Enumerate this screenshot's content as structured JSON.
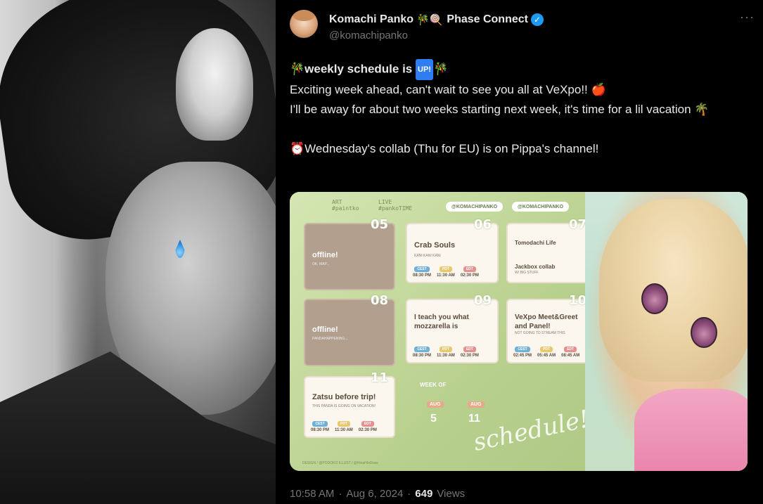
{
  "tweet": {
    "display_name": "Komachi Panko",
    "name_emojis": "🎋🍭",
    "organization": "Phase Connect",
    "handle": "@komachipanko",
    "more_label": "···",
    "body": {
      "line1_prefix_emoji": "🎋",
      "line1_text": "weekly schedule is",
      "line1_badge": "UP!",
      "line1_suffix_emoji": "🎋",
      "line2": "Exciting week ahead, can't wait to see you all at VeXpo!! 🍎",
      "line3": "I'll be away for about two weeks starting next week, it's time for a lil vacation 🌴",
      "line4_emoji": "⏰",
      "line4_text": "Wednesday's collab (Thu for EU) is on Pippa's channel!"
    },
    "meta": {
      "time": "10:58 AM",
      "sep1": "·",
      "date": "Aug 6, 2024",
      "sep2": "·",
      "views_count": "649",
      "views_label": "Views"
    }
  },
  "schedule": {
    "header_art": "ART",
    "header_art_tag": "#paintko",
    "header_live": "LIVE",
    "header_live_tag": "#pankoTIME",
    "handle_twitter": "@KOMACHIPANKO",
    "handle_youtube": "@KOMACHIPANKO",
    "days": [
      {
        "num": "05",
        "title": "offline!",
        "sub": "OK, MAP...",
        "offline": true
      },
      {
        "num": "06",
        "title": "Crab Souls",
        "sub": "KANI KANI KANI",
        "times": [
          "08:30 PM",
          "11:30 AM",
          "02:30 PM"
        ]
      },
      {
        "num": "07",
        "title": "Tomodachi Life",
        "title2": "Jackbox collab",
        "sub": "W/ BIG STUFF"
      },
      {
        "num": "08",
        "title": "offline!",
        "sub": "PANDAHAPPENING...",
        "offline": true
      },
      {
        "num": "09",
        "title": "I teach you what mozzarella is",
        "times": [
          "08:30 PM",
          "11:30 AM",
          "02:30 PM"
        ]
      },
      {
        "num": "10",
        "title": "VeXpo Meet&Greet and Panel!",
        "sub": "NOT GOING TO STREAM THIS",
        "times": [
          "02:45 PM",
          "05:45 AM",
          "08:45 AM"
        ]
      },
      {
        "num": "11",
        "title": "Zatsu before trip!",
        "sub": "THIS PANDA IS GOING ON VACATION!",
        "times": [
          "08:30 PM",
          "11:30 AM",
          "02:30 PM"
        ]
      }
    ],
    "tz_labels": [
      "CEST",
      "PDT",
      "EDT"
    ],
    "week_of_label": "WEEK OF",
    "week_from_month": "AUG",
    "week_from_day": "5",
    "week_to_month": "AUG",
    "week_to_day": "11",
    "script_text": "schedule!",
    "credits": "DESIGN / @PODOKO  ILLUST / @HinaHInDraw"
  },
  "colors": {
    "background": "#000000",
    "text": "#e7e9ea",
    "muted": "#71767b",
    "verified": "#1d9bf0"
  }
}
